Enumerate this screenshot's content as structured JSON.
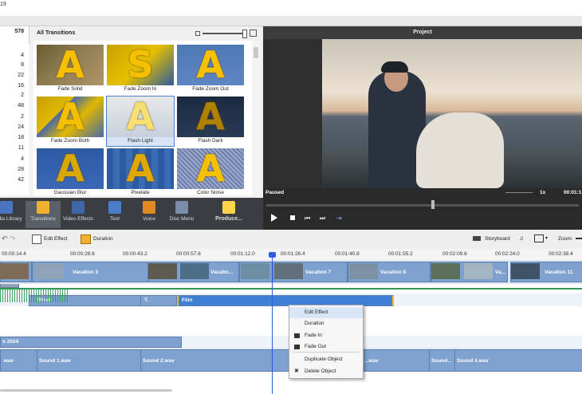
{
  "title_fragment": "19",
  "counts": [
    "578",
    "4",
    "8",
    "22",
    "16",
    "2",
    "48",
    "2",
    "24",
    "18",
    "11",
    "4",
    "28",
    "42"
  ],
  "transitions": {
    "header": "All Transitions",
    "items": [
      {
        "label": "Fade Solid",
        "glyph": "A",
        "style": "solid"
      },
      {
        "label": "Fade Zoom In",
        "glyph": "S",
        "style": "zoomin"
      },
      {
        "label": "Fade Zoom Out",
        "glyph": "A",
        "style": "zoomout"
      },
      {
        "label": "Fade Zoom Both",
        "glyph": "A",
        "style": "zoomboth"
      },
      {
        "label": "Flash Light",
        "glyph": "A",
        "style": "flashlight"
      },
      {
        "label": "Flash Dark",
        "glyph": "A",
        "style": "flashdark"
      },
      {
        "label": "Gaussian Blur",
        "glyph": "A",
        "style": "blur"
      },
      {
        "label": "Pixelate",
        "glyph": "A",
        "style": "pixelate"
      },
      {
        "label": "Color Noise",
        "glyph": "A",
        "style": "noise"
      }
    ]
  },
  "preview": {
    "title": "Project",
    "status": "Paused",
    "speed": "1x",
    "time": "00:01:1"
  },
  "modules": [
    {
      "label": "Media Library"
    },
    {
      "label": "Transitions"
    },
    {
      "label": "Video Effects"
    },
    {
      "label": "Text"
    },
    {
      "label": "Voice"
    },
    {
      "label": "Disc Menu"
    },
    {
      "label": "Produce..."
    }
  ],
  "timeline_toolbar": {
    "edit_effect": "Edit Effect",
    "duration": "Duration",
    "storyboard": "Storyboard",
    "zoom": "Zoom:"
  },
  "ruler_ticks": [
    "00:00:14.4",
    "00:00:28.8",
    "00:00:43.2",
    "00:00:57.6",
    "00:01:12.0",
    "00:01:26.4",
    "00:01:40.8",
    "00:01:55.2",
    "00:02:09.6",
    "00:02:24.0",
    "00:02:38.4"
  ],
  "clips": {
    "video": [
      "Vac...",
      "Vacation 3",
      "Vacatio...",
      "Vacation 7",
      "Vacation 8",
      "Va...",
      "Vacation 11"
    ],
    "effects": [
      "Wind",
      "T.",
      "Film"
    ],
    "title_track": "n 2024",
    "audio": [
      ".wav",
      "Sound 1.wav",
      "Sound 2.wav",
      "...wav",
      "Sound...",
      "Sound 4.wav"
    ]
  },
  "context_menu": {
    "items": [
      {
        "label": "Edit Effect"
      },
      {
        "label": "Duration"
      },
      {
        "label": "Fade In"
      },
      {
        "label": "Fade Out"
      },
      {
        "label": "Duplicate Object"
      },
      {
        "label": "Delete Object"
      }
    ]
  },
  "colors": {
    "accent": "#4a82c8",
    "clip": "#7fa1cf",
    "effect_clip": "#3f7fd6",
    "audio_wave": "#2e9a52",
    "playhead": "#2b5fd9"
  }
}
